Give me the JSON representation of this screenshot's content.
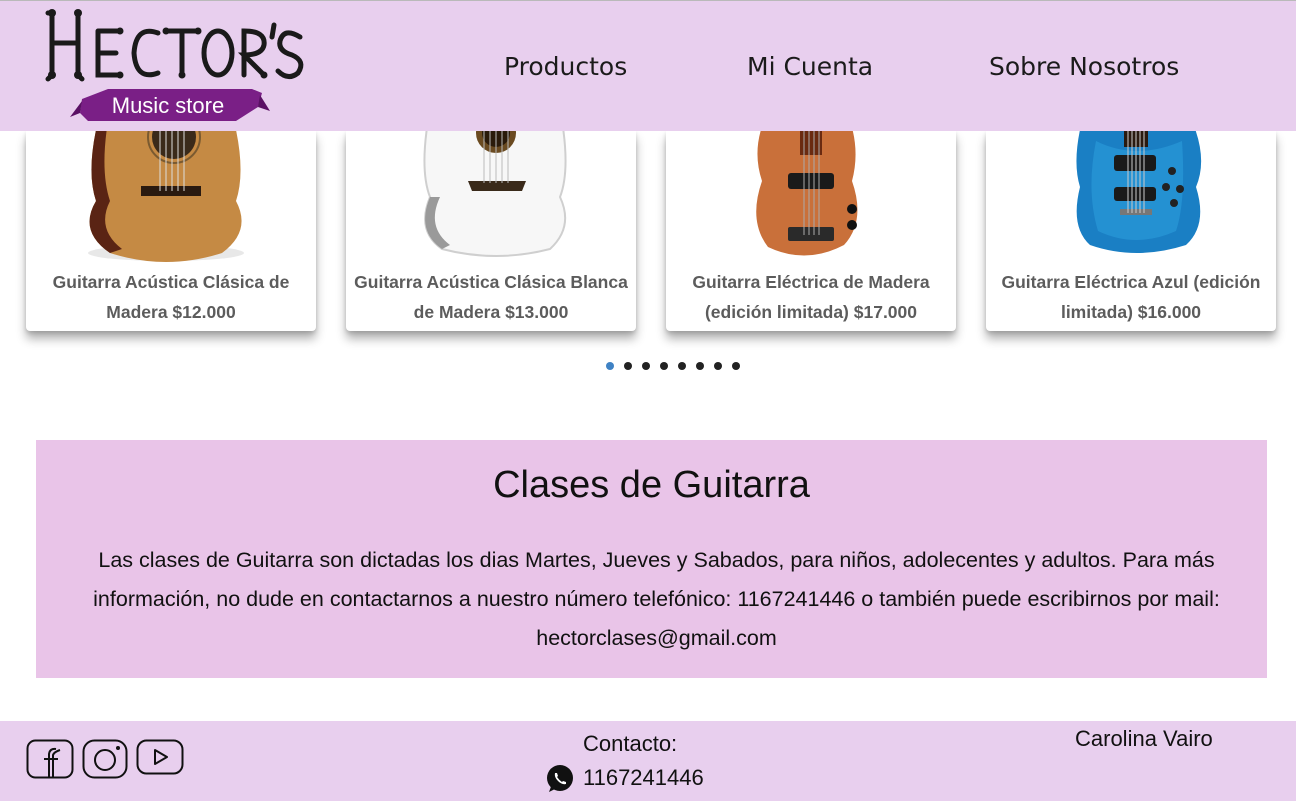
{
  "brand": {
    "logo_title": "HECTOR'S",
    "logo_subtitle": "Music store"
  },
  "nav": {
    "items": [
      "Productos",
      "Mi Cuenta",
      "Sobre Nosotros"
    ]
  },
  "carousel": {
    "products": [
      {
        "caption": "Guitarra Acústica Clásica de Madera $12.000",
        "image": "classical-guitar-wood"
      },
      {
        "caption": "Guitarra Acústica Clásica Blanca de Madera $13.000",
        "image": "classical-guitar-white"
      },
      {
        "caption": "Guitarra Eléctrica de Madera (edición limitada) $17.000",
        "image": "electric-bass-wood"
      },
      {
        "caption": "Guitarra Eléctrica Azul (edición limitada) $16.000",
        "image": "electric-guitar-blue"
      }
    ],
    "dot_count": 8,
    "active_dot": 0
  },
  "clases": {
    "title": "Clases de Guitarra",
    "text": "Las clases de Guitarra son dictadas los dias Martes, Jueves y Sabados, para niños, adolecentes y adultos. Para más información, no dude en contactarnos a nuestro número telefónico: 1167241446 o también puede escribirnos por mail: hectorclases@gmail.com"
  },
  "footer": {
    "social": [
      "facebook-icon",
      "instagram-icon",
      "youtube-icon"
    ],
    "contact_label": "Contacto:",
    "phone": "1167241446",
    "author": "Carolina Vairo"
  },
  "colors": {
    "header_bg": "#e8cfee",
    "section_bg": "#e9c4e8",
    "caption_text": "#5c5c5c",
    "active_dot": "#3f82c4",
    "logo_purple": "#7a1f86"
  }
}
